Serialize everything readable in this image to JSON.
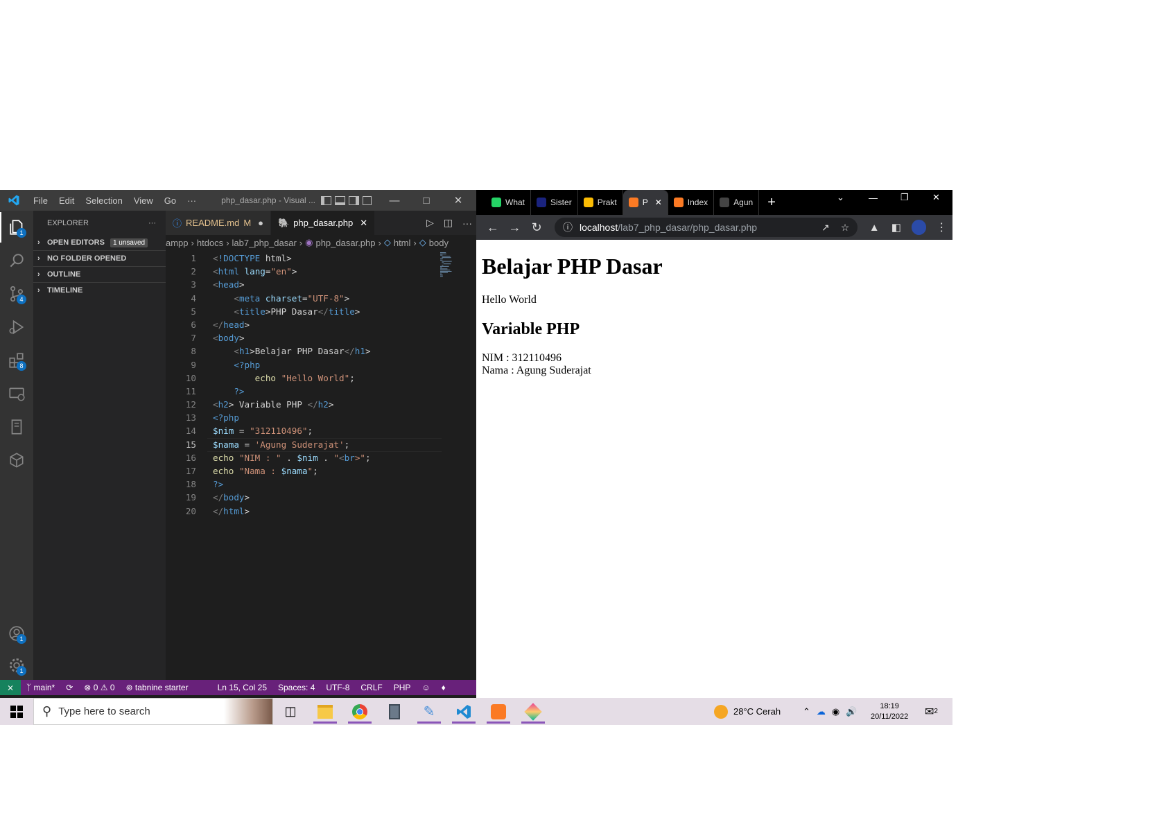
{
  "vscode": {
    "menu": [
      "File",
      "Edit",
      "Selection",
      "View",
      "Go",
      "···"
    ],
    "window_title": "php_dasar.php - Visual ...",
    "activity_badges": {
      "explorer": "1",
      "scm": "4",
      "extensions": "8",
      "accounts": "1",
      "settings": "1"
    },
    "explorer_title": "EXPLORER",
    "explorer_more": "···",
    "sections": {
      "open_editors": "OPEN EDITORS",
      "unsaved": "1 unsaved",
      "no_folder": "NO FOLDER OPENED",
      "outline": "OUTLINE",
      "timeline": "TIMELINE"
    },
    "tabs": [
      {
        "label": "README.md",
        "modified": "M"
      },
      {
        "label": "php_dasar.php"
      }
    ],
    "breadcrumb": [
      "ampp",
      "htdocs",
      "lab7_php_dasar",
      "php_dasar.php",
      "html",
      "body"
    ],
    "code_lines": [
      "<!DOCTYPE html>",
      "<html lang=\"en\">",
      "<head>",
      "    <meta charset=\"UTF-8\">",
      "    <title>PHP Dasar</title>",
      "</head>",
      "<body>",
      "    <h1>Belajar PHP Dasar</h1>",
      "    <?php",
      "        echo \"Hello World\";",
      "    ?>",
      "<h2> Variable PHP </h2>",
      "<?php",
      "$nim = \"312110496\";",
      "$nama = 'Agung Suderajat';",
      "echo \"NIM : \" . $nim . \"<br>\";",
      "echo \"Nama : $nama\";",
      "?>",
      "</body>",
      "</html>"
    ],
    "line_numbers": [
      "1",
      "2",
      "3",
      "4",
      "5",
      "6",
      "7",
      "8",
      "9",
      "10",
      "11",
      "12",
      "13",
      "14",
      "15",
      "16",
      "17",
      "18",
      "19",
      "20"
    ],
    "current_line": 15,
    "status": {
      "branch": "main*",
      "errors": "0",
      "warnings": "0",
      "tabnine": "tabnine starter",
      "position": "Ln 15, Col 25",
      "spaces": "Spaces: 4",
      "encoding": "UTF-8",
      "eol": "CRLF",
      "language": "PHP"
    }
  },
  "chrome": {
    "tabs": [
      {
        "label": "What",
        "favicon_color": "#25d366"
      },
      {
        "label": "Sister",
        "favicon_color": "#1a237e"
      },
      {
        "label": "Prakt",
        "favicon_color": "#fbbc04"
      },
      {
        "label": "P",
        "favicon_color": "#fb7a24",
        "active": true
      },
      {
        "label": "Index",
        "favicon_color": "#fb7a24"
      },
      {
        "label": "Agun",
        "favicon_color": "#444444"
      }
    ],
    "new_tab": "+",
    "url_host": "localhost",
    "url_path": "/lab7_php_dasar/php_dasar.php",
    "page": {
      "h1": "Belajar PHP Dasar",
      "hello": "Hello World",
      "h2": "Variable PHP",
      "nim": "NIM : 312110496",
      "nama": "Nama : Agung Suderajat"
    }
  },
  "taskbar": {
    "search_placeholder": "Type here to search",
    "weather": "28°C  Cerah",
    "time": "18:19",
    "date": "20/11/2022",
    "notifications": "2"
  }
}
